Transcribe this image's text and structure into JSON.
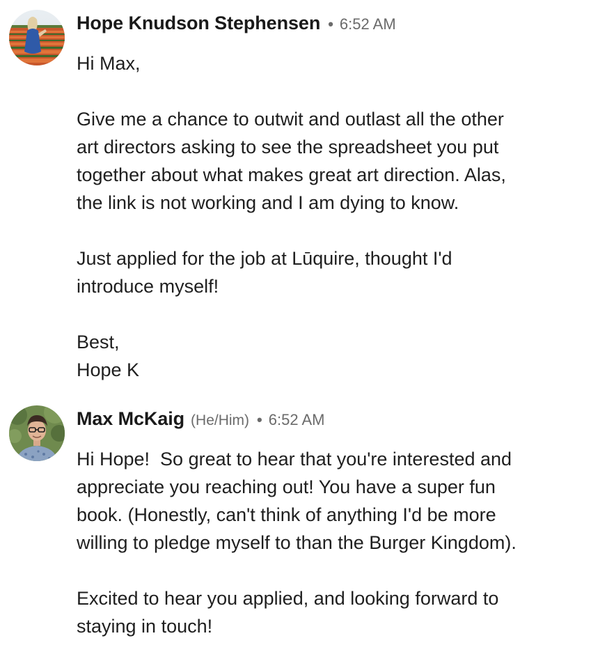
{
  "messages": [
    {
      "sender": "Hope Knudson Stephensen",
      "pronouns": "",
      "separator": "•",
      "time": "6:52 AM",
      "avatar_icon": "profile-photo",
      "paragraphs": [
        [
          "Hi Max,"
        ],
        [
          "Give me a chance to outwit and outlast all the other",
          "art directors asking to see the spreadsheet you put",
          "together about what makes great art direction. Alas,",
          "the link is not working and I am dying to know."
        ],
        [
          "Just applied for the job at Lūquire, thought I'd",
          "introduce myself!"
        ],
        [
          "Best,",
          "Hope K"
        ]
      ]
    },
    {
      "sender": "Max McKaig",
      "pronouns": "(He/Him)",
      "separator": "•",
      "time": "6:52 AM",
      "avatar_icon": "profile-photo",
      "paragraphs": [
        [
          "Hi Hope!  So great to hear that you're interested and",
          "appreciate you reaching out! You have a super fun",
          "book. (Honestly, can't think of anything I'd be more",
          "willing to pledge myself to than the Burger Kingdom)."
        ],
        [
          "Excited to hear you applied, and looking forward to",
          "staying in touch!"
        ]
      ]
    }
  ]
}
